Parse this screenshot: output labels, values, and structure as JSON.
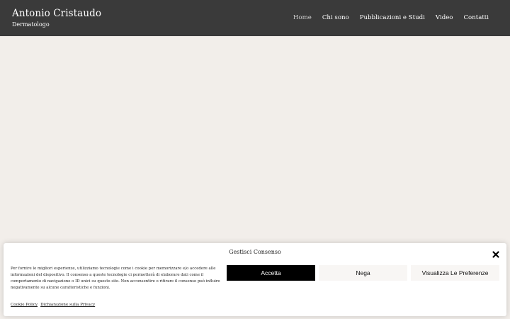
{
  "header": {
    "brand_title": "Antonio Cristaudo",
    "brand_subtitle": "Dermatologo",
    "nav": [
      {
        "label": "Home",
        "active": true
      },
      {
        "label": "Chi sono"
      },
      {
        "label": "Pubblicazioni e Studi"
      },
      {
        "label": "Video"
      },
      {
        "label": "Contatti"
      }
    ]
  },
  "consent": {
    "title": "Gestisci Consenso",
    "text": "Per fornire le migliori esperienze, utilizziamo tecnologie come i cookie per memorizzare e/o accedere alle informazioni del dispositivo. Il consenso a queste tecnologie ci permetterà di elaborare dati come il comportamento di navigazione o ID unici su questo sito. Non acconsentire o ritirare il consenso può influire negativamente su alcune caratteristiche e funzioni.",
    "accept_label": "Accetta",
    "deny_label": "Nega",
    "prefs_label": "Visualizza Le Preferenze",
    "links": [
      "Cookie Policy",
      "Dichiarazione sulla Privacy"
    ],
    "close_icon": "close-icon"
  },
  "colors": {
    "header_bg": "#3a3a3a",
    "page_bg": "#f2eeea",
    "accept_bg": "#000000"
  }
}
